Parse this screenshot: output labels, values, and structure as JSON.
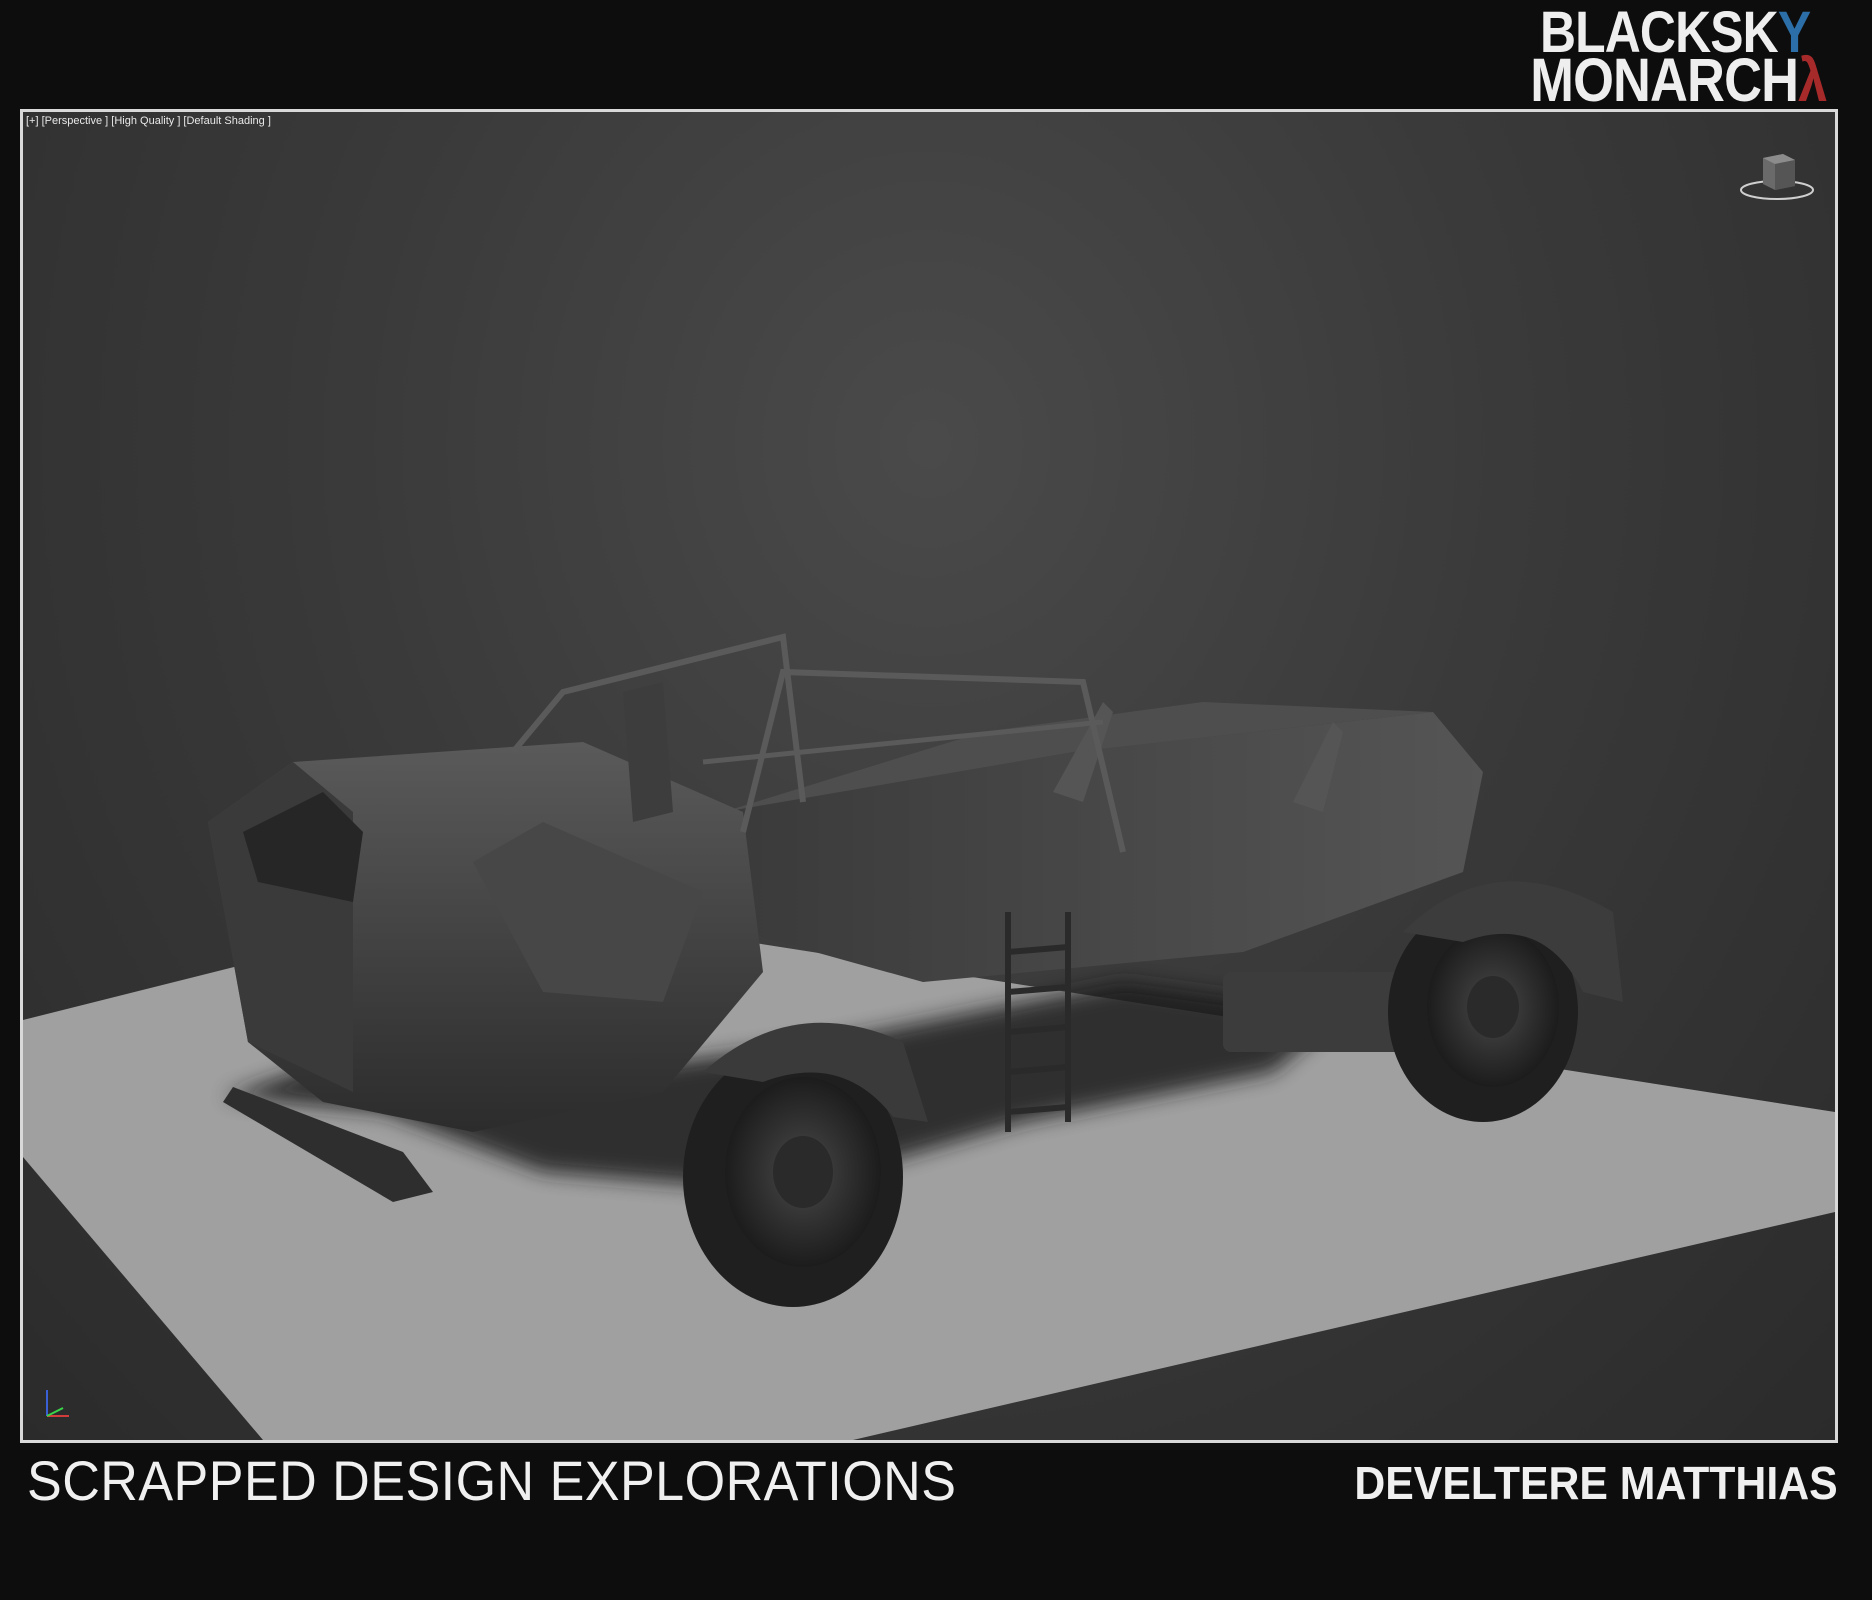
{
  "logo": {
    "line1_main": "BLACKSK",
    "line1_accent": "Y",
    "line2_main": "MONARCH",
    "line2_accent": "λ"
  },
  "viewport": {
    "label": "[+] [Perspective ] [High Quality ] [Default Shading ]",
    "viewcube_icon": "viewcube-icon",
    "axis_icon": "axis-tripod-icon",
    "model_description_icon": "vehicle-model-render"
  },
  "footer": {
    "title": "SCRAPPED DESIGN EXPLORATIONS",
    "author": "DEVELTERE MATTHIAS"
  },
  "colors": {
    "logo_blue": "#2c6ea7",
    "logo_red": "#a72a2a",
    "frame": "#d9d9d9",
    "background": "#0d0d0d"
  }
}
